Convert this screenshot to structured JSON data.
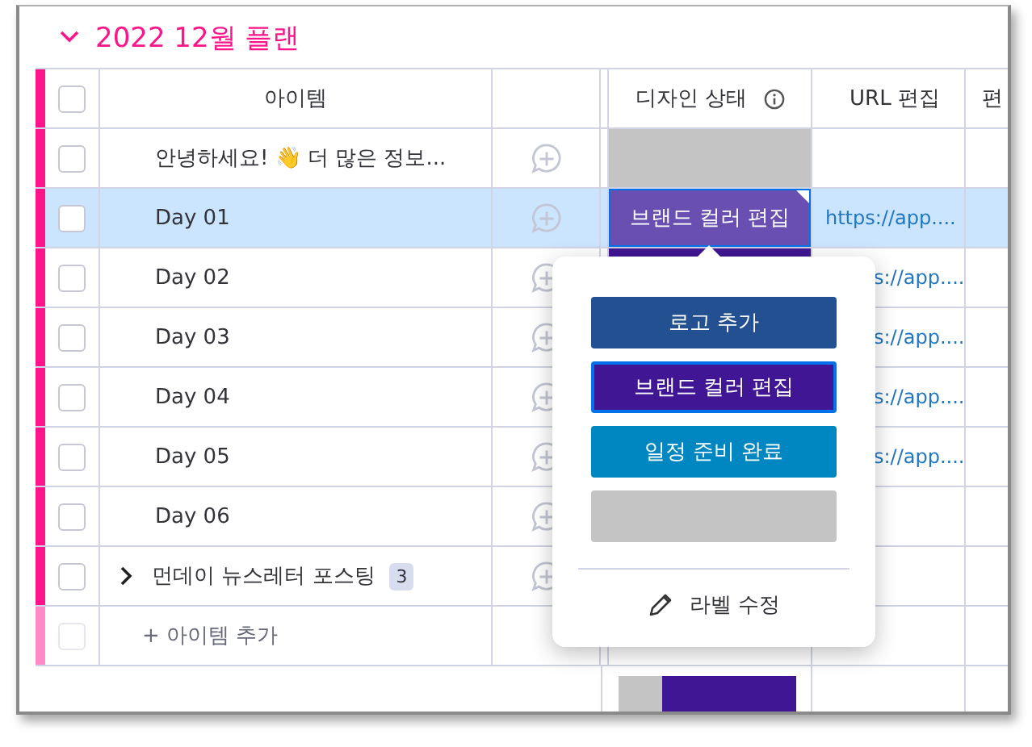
{
  "group": {
    "title": "2022 12월 플랜",
    "expanded": true,
    "color": "#ff158a"
  },
  "select_all": {
    "checked": false
  },
  "columns": [
    {
      "label": "아이템"
    },
    {
      "label": "디자인 상태",
      "info": true
    },
    {
      "label": "URL 편집"
    },
    {
      "label": "편"
    }
  ],
  "rows": [
    {
      "kind": "item",
      "name": "안녕하세요! 👋 더 많은 정보...",
      "selected": false,
      "status": {
        "color": "#c4c4c4"
      }
    },
    {
      "kind": "item",
      "name": "Day 01",
      "selected": true,
      "status": {
        "label": "브랜드 컬러 편집",
        "color": "#6a4fb3"
      },
      "url": "https://app...."
    },
    {
      "kind": "item",
      "name": "Day 02",
      "selected": false,
      "status": {
        "color": "#401694"
      },
      "url": "s://app...."
    },
    {
      "kind": "item",
      "name": "Day 03",
      "selected": false,
      "url": "s://app...."
    },
    {
      "kind": "item",
      "name": "Day 04",
      "selected": false,
      "url": "s://app...."
    },
    {
      "kind": "item",
      "name": "Day 05",
      "selected": false,
      "url": "s://app...."
    },
    {
      "kind": "item",
      "name": "Day 06",
      "selected": false
    },
    {
      "kind": "group",
      "name": "먼데이 뉴스레터 포스팅",
      "count": "3",
      "selected": false,
      "expanded": false
    }
  ],
  "add_row": {
    "label": "+ 아이템 추가",
    "checked": false
  },
  "summary": {
    "level": 0.25
  },
  "label_menu": {
    "labels": [
      {
        "label": "로고 추가",
        "color": "#225091",
        "selected": false
      },
      {
        "label": "브랜드 컬러 편집",
        "color": "#401694",
        "selected": true
      },
      {
        "label": "일정 준비 완료",
        "color": "#0086c0",
        "selected": false
      },
      {
        "color": "#c4c4c4",
        "selected": false
      }
    ],
    "edit": "라벨 수정"
  }
}
